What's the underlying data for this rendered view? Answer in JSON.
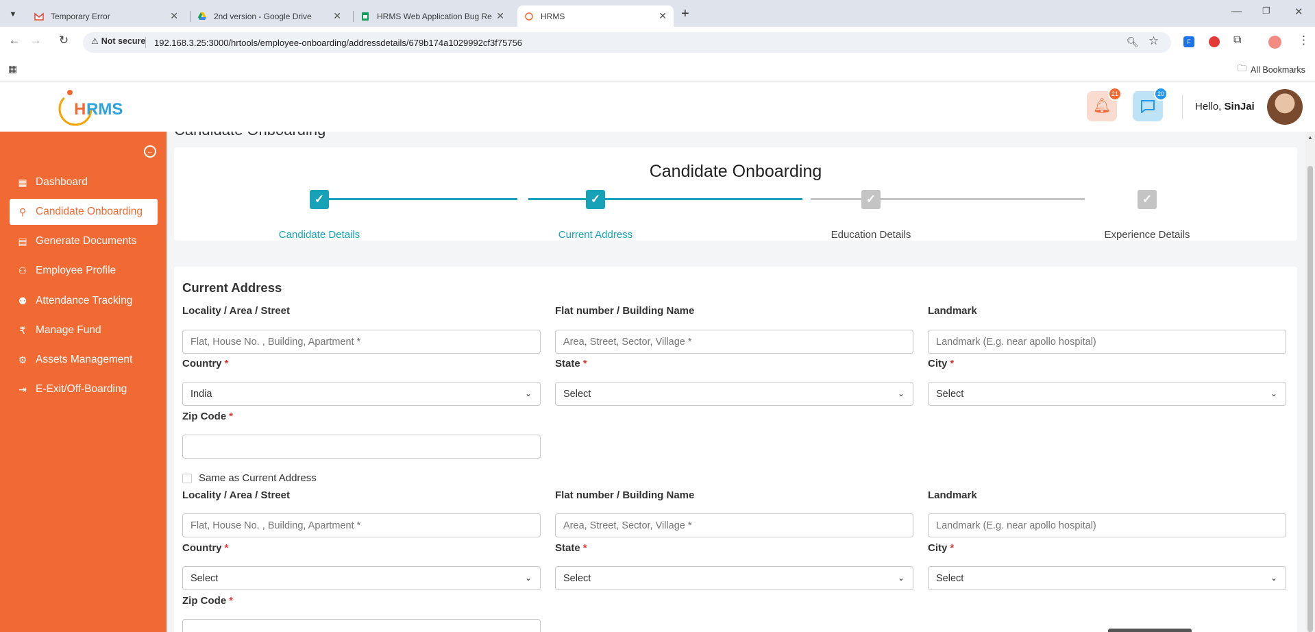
{
  "browser": {
    "tabs": [
      {
        "title": "Temporary Error",
        "icon": "gmail-icon"
      },
      {
        "title": "2nd version - Google Drive",
        "icon": "google-drive-icon"
      },
      {
        "title": "HRMS Web Application Bug Re",
        "icon": "google-sheets-icon"
      },
      {
        "title": "HRMS",
        "icon": "hrms-favicon-icon"
      }
    ],
    "not_secure": "Not secure",
    "url": "192.168.3.25:3000/hrtools/employee-onboarding/addressdetails/679b174a1029992cf3f75756",
    "all_bookmarks": "All Bookmarks"
  },
  "header": {
    "logo_text": "HRMS",
    "notification_count": "21",
    "message_count": "20",
    "greeting": "Hello,",
    "username": "SinJai"
  },
  "sidebar": {
    "items": [
      {
        "label": "Dashboard",
        "icon": "dashboard-icon"
      },
      {
        "label": "Candidate Onboarding",
        "icon": "user-plus-icon"
      },
      {
        "label": "Generate Documents",
        "icon": "document-icon"
      },
      {
        "label": "Employee Profile",
        "icon": "users-icon"
      },
      {
        "label": "Attendance Tracking",
        "icon": "attendance-icon"
      },
      {
        "label": "Manage Fund",
        "icon": "rupee-icon"
      },
      {
        "label": "Assets Management",
        "icon": "settings-icon"
      },
      {
        "label": "E-Exit/Off-Boarding",
        "icon": "exit-icon"
      }
    ]
  },
  "page": {
    "partial_title": "Candidate Onboarding",
    "stepper_title": "Candidate Onboarding",
    "steps": [
      {
        "label": "Candidate Details",
        "status": "complete"
      },
      {
        "label": "Current Address",
        "status": "complete"
      },
      {
        "label": "Education Details",
        "status": "pending"
      },
      {
        "label": "Experience Details",
        "status": "pending"
      }
    ],
    "section_title": "Current Address",
    "current": {
      "locality_label": "Locality / Area / Street",
      "locality_placeholder": "Flat, House No. , Building, Apartment *",
      "flat_label": "Flat number / Building Name",
      "flat_placeholder": "Area, Street, Sector, Village *",
      "landmark_label": "Landmark",
      "landmark_placeholder": "Landmark (E.g. near apollo hospital)",
      "country_label": "Country",
      "country_value": "India",
      "state_label": "State",
      "state_value": "Select",
      "city_label": "City",
      "city_value": "Select",
      "zip_label": "Zip Code",
      "zip_value": ""
    },
    "same_as_label": "Same as Current Address",
    "permanent": {
      "locality_label": "Locality / Area / Street",
      "locality_placeholder": "Flat, House No. , Building, Apartment *",
      "flat_label": "Flat number / Building Name",
      "flat_placeholder": "Area, Street, Sector, Village *",
      "landmark_label": "Landmark",
      "landmark_placeholder": "Landmark (E.g. near apollo hospital)",
      "country_label": "Country",
      "country_value": "Select",
      "state_label": "State",
      "state_value": "Select",
      "city_label": "City",
      "city_value": "Select",
      "zip_label": "Zip Code"
    },
    "required_mark": "*"
  },
  "colors": {
    "brand_orange": "#f26a33",
    "step_teal": "#17a2b8",
    "step_grey": "#c4c4c4"
  }
}
